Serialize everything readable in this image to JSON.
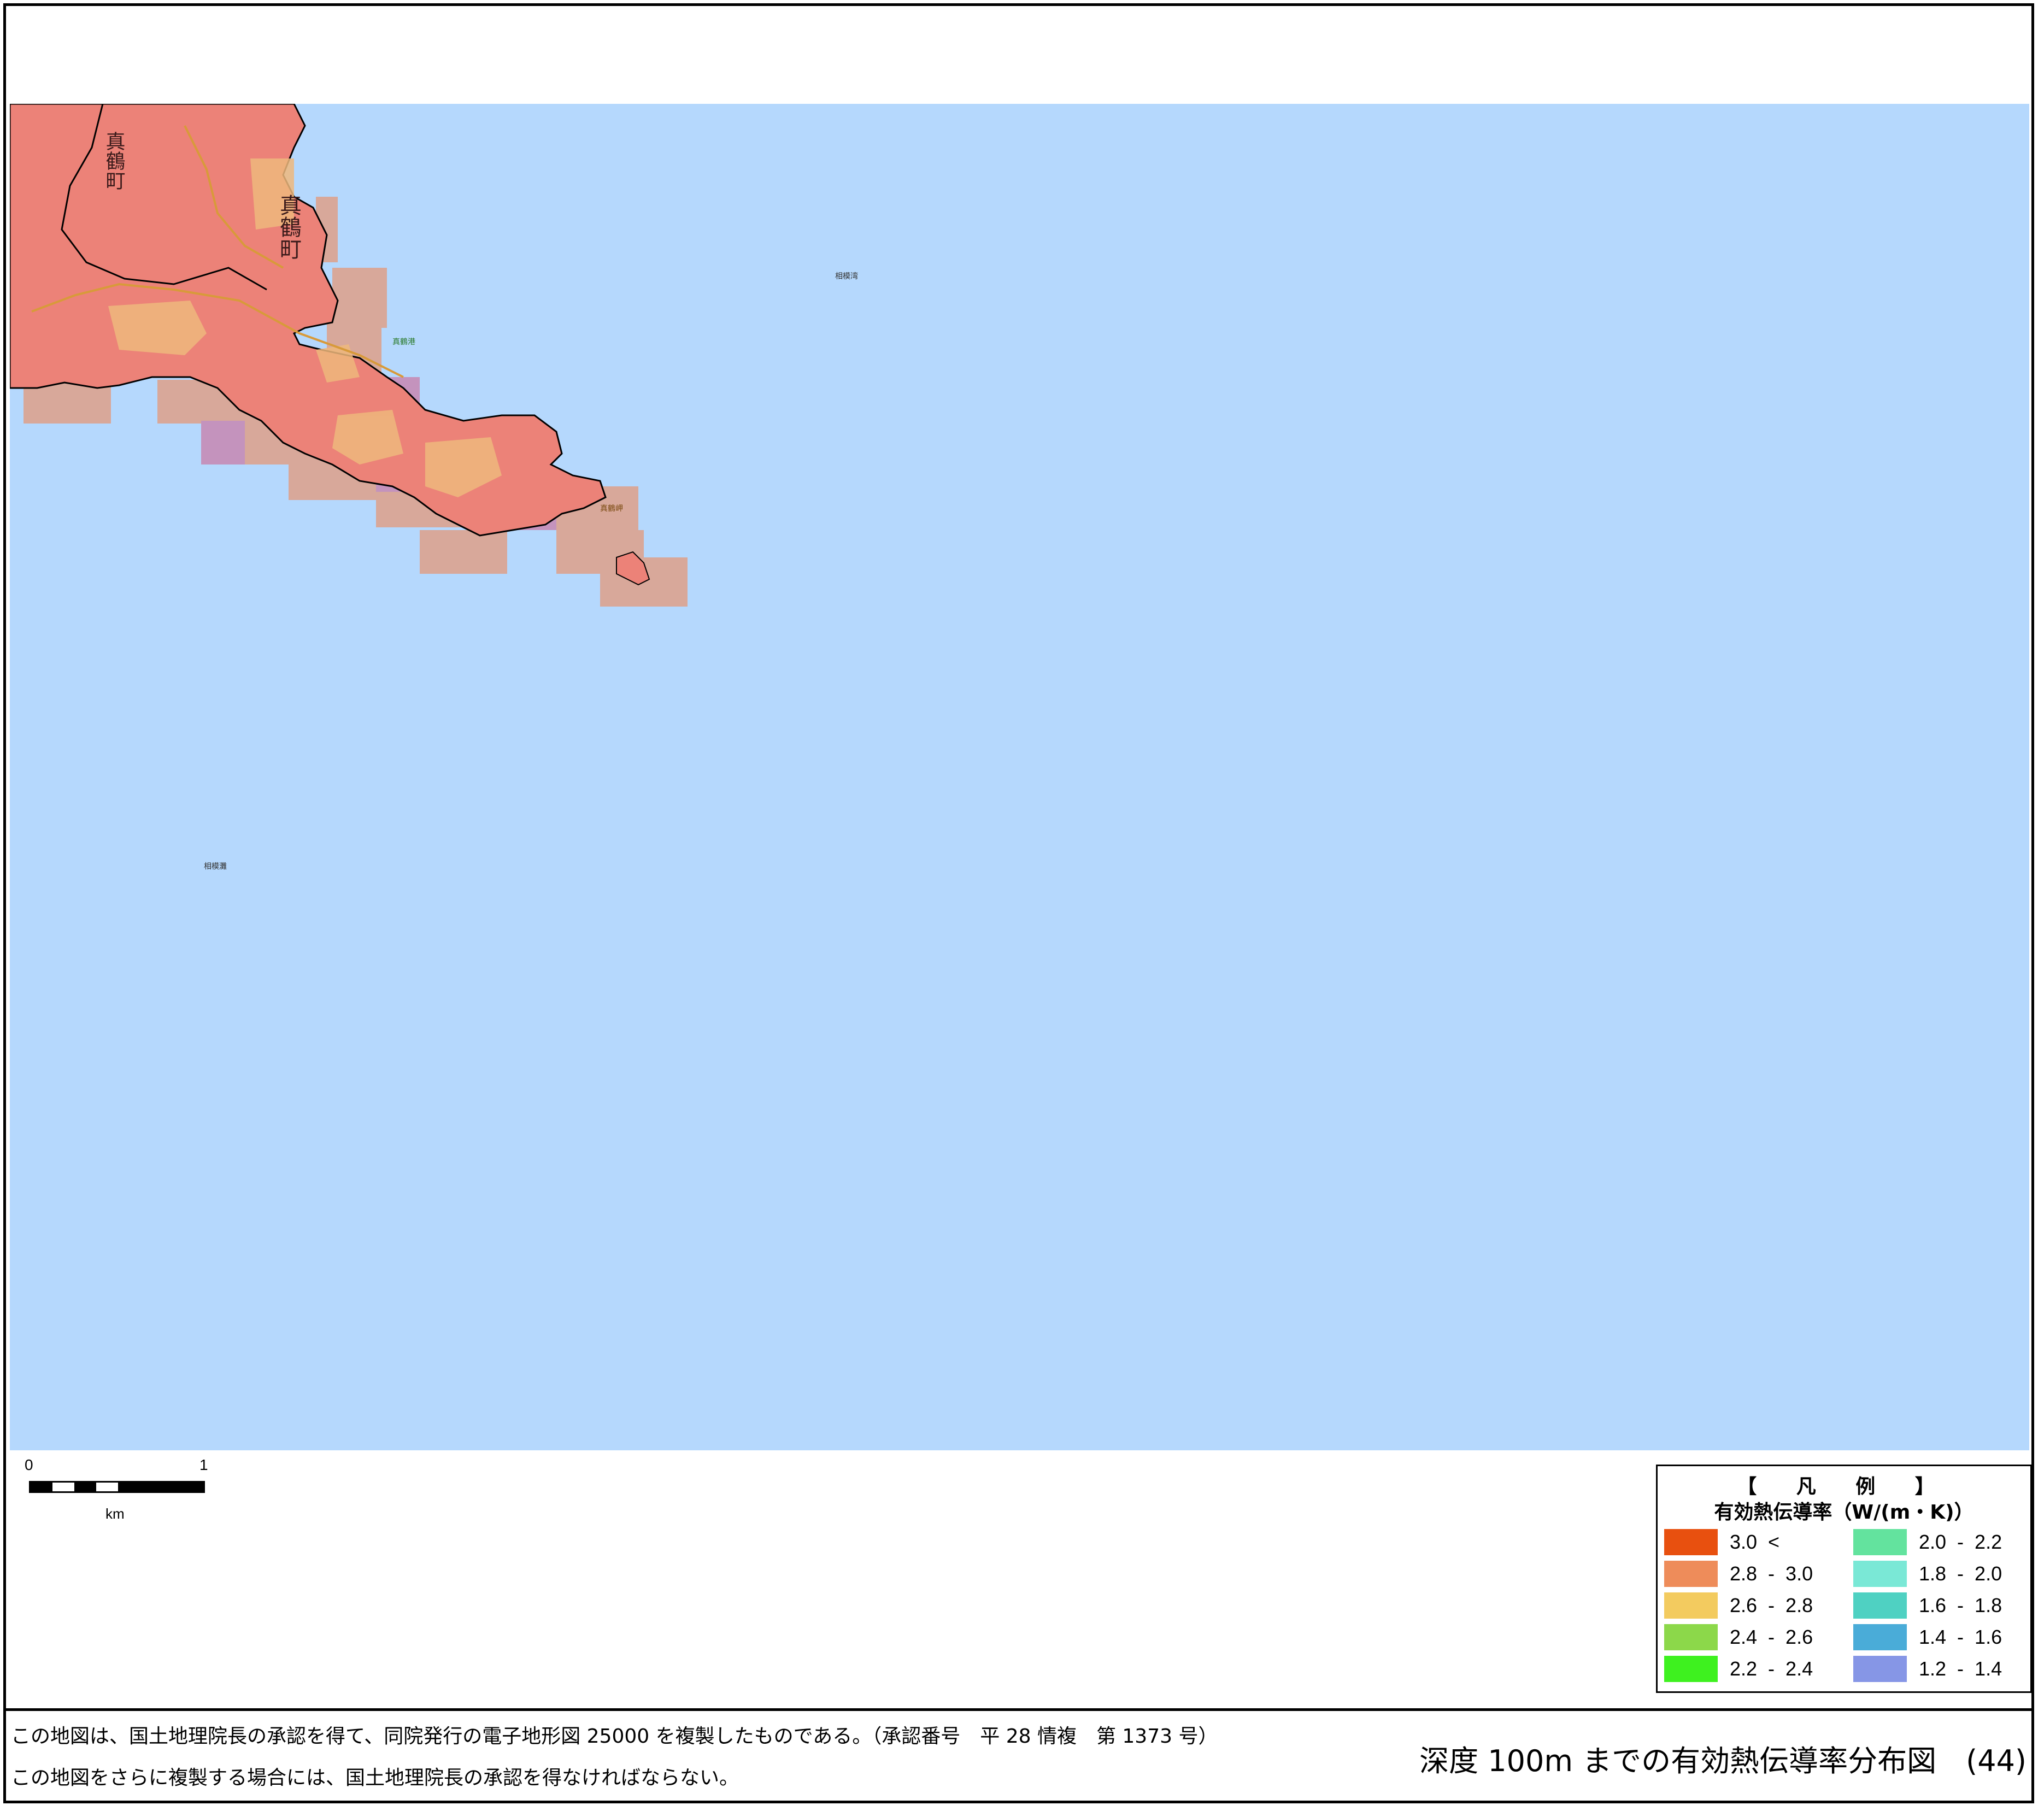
{
  "map": {
    "place_labels": {
      "town_upper": "真鶴町",
      "town_center": "真鶴町",
      "bay_name": "相模湾",
      "sea_name": "相模灘",
      "port_name": "真鶴港",
      "cape_name": "真鶴岬"
    },
    "colors": {
      "sea": "#b5d8fd",
      "land_high": "#ec8278",
      "land_mid": "#efb87c",
      "grid_cell": "#d8a89a",
      "grid_cell_purple": "#c493bd",
      "coastline": "#000000"
    }
  },
  "scalebar": {
    "tick_start": "0",
    "tick_end": "1",
    "unit": "km"
  },
  "legend": {
    "title": "【 凡 例 】",
    "subtitle": "有効熱伝導率（W/(m・K)）",
    "items_left": [
      {
        "label": "3.0  <",
        "color": "#e8500f"
      },
      {
        "label": "2.8  -  3.0",
        "color": "#ee8c5a"
      },
      {
        "label": "2.6  -  2.8",
        "color": "#f3cb5f"
      },
      {
        "label": "2.4  -  2.6",
        "color": "#8cd84a"
      },
      {
        "label": "2.2  -  2.4",
        "color": "#3ef11f"
      }
    ],
    "items_right": [
      {
        "label": "2.0  -  2.2",
        "color": "#63e39e"
      },
      {
        "label": "1.8  -  2.0",
        "color": "#7ae8d6"
      },
      {
        "label": "1.6  -  1.8",
        "color": "#4fd1c2"
      },
      {
        "label": "1.4  -  1.6",
        "color": "#4aacd8"
      },
      {
        "label": "1.2  -  1.4",
        "color": "#8696e6"
      }
    ]
  },
  "footer": {
    "note_line1": "この地図は、国土地理院長の承認を得て、同院発行の電子地形図 25000 を複製したものである。（承認番号　平 28 情複　第 1373 号）",
    "note_line2": "この地図をさらに複製する場合には、国土地理院長の承認を得なければならない。",
    "sheet_title": "深度 100m までの有効熱伝導率分布図　(44)"
  }
}
